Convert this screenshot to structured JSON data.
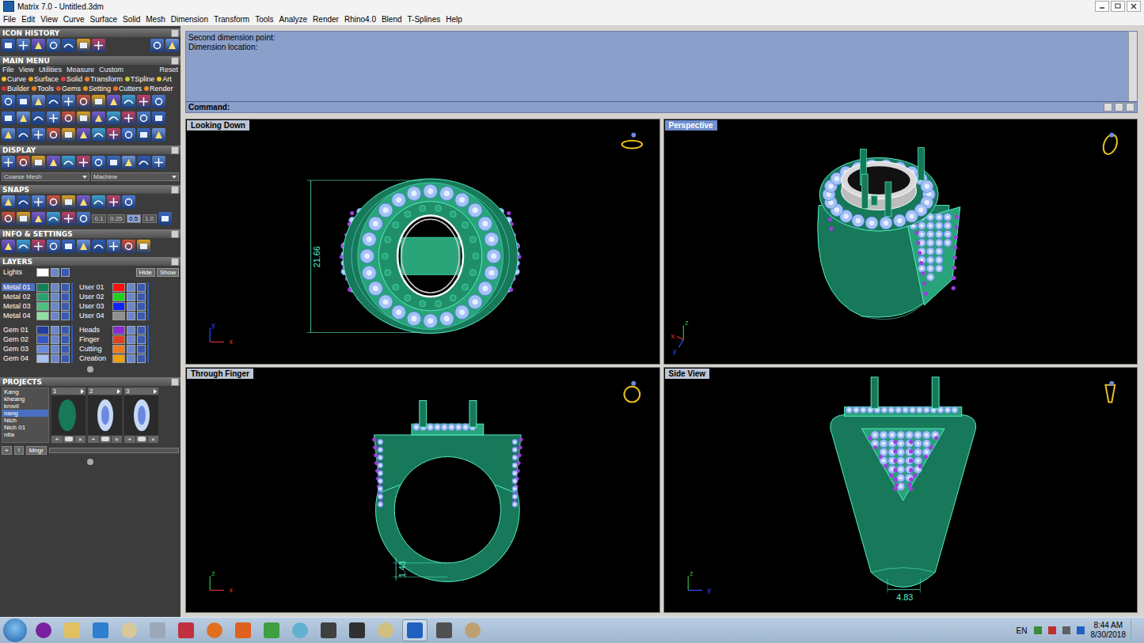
{
  "window": {
    "title": "Matrix 7.0 - Untitled.3dm"
  },
  "menu": [
    "File",
    "Edit",
    "View",
    "Curve",
    "Surface",
    "Solid",
    "Mesh",
    "Dimension",
    "Transform",
    "Tools",
    "Analyze",
    "Render",
    "Rhino4.0",
    "Blend",
    "T-Splines",
    "Help"
  ],
  "panel": {
    "icon_history": {
      "title": "ICON HISTORY"
    },
    "main_menu": {
      "title": "MAIN MENU",
      "tabs": [
        "File",
        "View",
        "Utilities",
        "Measure",
        "Custom"
      ],
      "reset": "Reset",
      "categories": [
        [
          {
            "label": "Curve",
            "color": "#f0c020"
          },
          {
            "label": "Surface",
            "color": "#f0a020"
          },
          {
            "label": "Solid",
            "color": "#e04040"
          },
          {
            "label": "Transform",
            "color": "#f08030"
          },
          {
            "label": "TSpline",
            "color": "#c0d030"
          },
          {
            "label": "Art",
            "color": "#f0c020"
          }
        ],
        [
          {
            "label": "Builder",
            "color": "#e03030"
          },
          {
            "label": "Tools",
            "color": "#f08020"
          },
          {
            "label": "Gems",
            "color": "#e05030"
          },
          {
            "label": "Setting",
            "color": "#f09020"
          },
          {
            "label": "Cutters",
            "color": "#f07020"
          },
          {
            "label": "Render",
            "color": "#f09030"
          }
        ]
      ]
    },
    "display": {
      "title": "DISPLAY",
      "mesh": "Coarse Mesh",
      "material": "Machine"
    },
    "snaps": {
      "title": "SNAPS",
      "values": [
        {
          "label": "0.1",
          "selected": false
        },
        {
          "label": "0.25",
          "selected": false
        },
        {
          "label": "0.5",
          "selected": true
        },
        {
          "label": "1.0",
          "selected": false
        }
      ]
    },
    "info": {
      "title": "INFO & SETTINGS"
    },
    "layers": {
      "title": "LAYERS",
      "lights": {
        "name": "Lights",
        "color": "#ffffff"
      },
      "hide": "Hide",
      "show": "Show",
      "groups": [
        {
          "left": [
            {
              "name": "Metal 01",
              "color": "#12805a",
              "selected": true
            },
            {
              "name": "Metal 02",
              "color": "#2aa070",
              "selected": false
            },
            {
              "name": "Metal 03",
              "color": "#50c080",
              "selected": false
            },
            {
              "name": "Metal 04",
              "color": "#90e0a0",
              "selected": false
            }
          ],
          "right": [
            {
              "name": "User 01",
              "color": "#ff1010",
              "selected": false
            },
            {
              "name": "User 02",
              "color": "#20d020",
              "selected": false
            },
            {
              "name": "User 03",
              "color": "#1020ff",
              "selected": false
            },
            {
              "name": "User 04",
              "color": "#909090",
              "selected": false
            }
          ]
        },
        {
          "left": [
            {
              "name": "Gem 01",
              "color": "#1e3ea0",
              "selected": false
            },
            {
              "name": "Gem 02",
              "color": "#3558c8",
              "selected": false
            },
            {
              "name": "Gem 03",
              "color": "#6a8ae0",
              "selected": false
            },
            {
              "name": "Gem 04",
              "color": "#a8c0f0",
              "selected": false
            }
          ],
          "right": [
            {
              "name": "Heads",
              "color": "#8a2ad0",
              "selected": false
            },
            {
              "name": "Finger",
              "color": "#e04020",
              "selected": false
            },
            {
              "name": "Cutting",
              "color": "#f07a20",
              "selected": false
            },
            {
              "name": "Creation",
              "color": "#f0a000",
              "selected": false
            }
          ]
        }
      ]
    },
    "projects": {
      "title": "PROJECTS",
      "names": [
        {
          "label": "Kang",
          "selected": false
        },
        {
          "label": "kheang",
          "selected": false
        },
        {
          "label": "krovil",
          "selected": false
        },
        {
          "label": "nang",
          "selected": true
        },
        {
          "label": "Nich",
          "selected": false
        },
        {
          "label": "Nich 01",
          "selected": false
        },
        {
          "label": "nita",
          "selected": false
        }
      ],
      "thumbs": [
        "1",
        "2",
        "3"
      ],
      "thumb_add": "+",
      "thumb_delete": "×",
      "tools": [
        "+",
        "↑",
        "Mngr"
      ]
    }
  },
  "command": {
    "lines": [
      "Second dimension point:",
      "Dimension location:"
    ],
    "prompt": "Command:"
  },
  "viewports": [
    {
      "label": "Looking Down",
      "kind": "top",
      "active": false,
      "dimension": "21.66",
      "axes": [
        "y",
        "x"
      ]
    },
    {
      "label": "Perspective",
      "kind": "perspective",
      "active": true,
      "axes": [
        "z",
        "x",
        "y"
      ]
    },
    {
      "label": "Through Finger",
      "kind": "front",
      "active": false,
      "dimension": "1.43",
      "axes": [
        "z",
        "x"
      ]
    },
    {
      "label": "Side View",
      "kind": "side",
      "active": false,
      "dimension": "4.83",
      "axes": [
        "z",
        "y"
      ]
    }
  ],
  "taskbar": {
    "language": "EN",
    "time": "8:44 AM",
    "date": "8/30/2018"
  }
}
